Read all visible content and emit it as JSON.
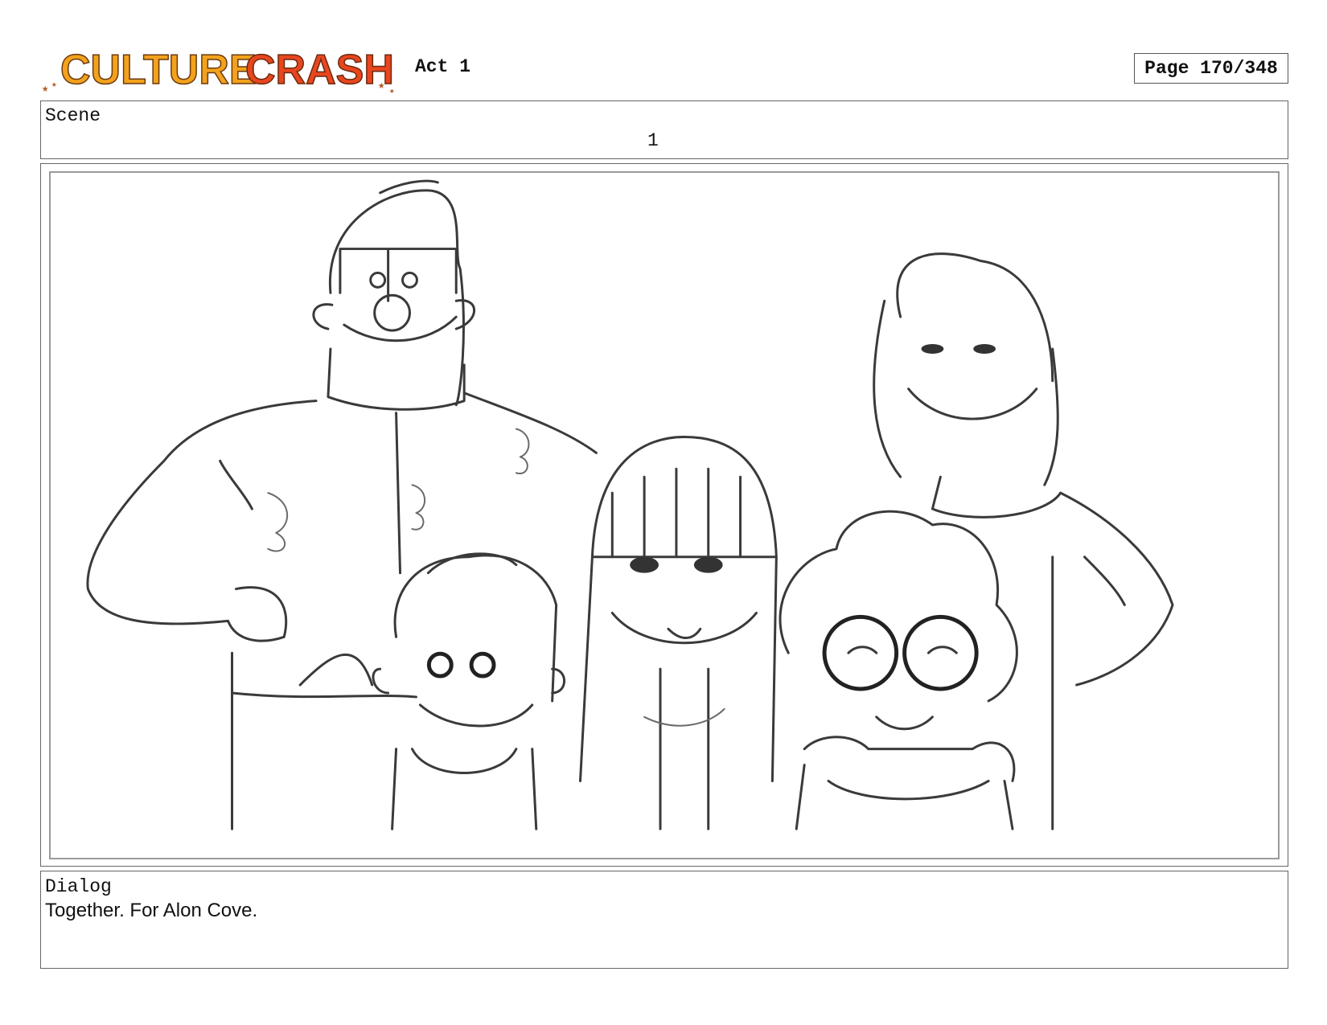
{
  "header": {
    "logo_text": "CULTURE CRASH",
    "act_label": "Act 1",
    "page_label": "Page 170/348"
  },
  "scene": {
    "label": "Scene",
    "number": "1"
  },
  "panel": {
    "icon": "storyboard-sketch"
  },
  "dialog": {
    "label": "Dialog",
    "text": "Together. For Alon Cove."
  },
  "colors": {
    "logo_yellow": "#f2a21c",
    "logo_red": "#e8461e",
    "border": "#666666"
  }
}
